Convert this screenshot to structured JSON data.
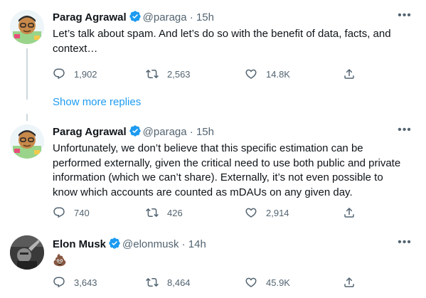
{
  "tweets": [
    {
      "name": "Parag Agrawal",
      "handle": "@paraga",
      "separator": "·",
      "time": "15h",
      "text": "Let’s talk about spam. And let’s do so with the benefit of data, facts, and\ncontext…",
      "replies": "1,902",
      "retweets": "2,563",
      "likes": "14.8K"
    },
    {
      "name": "Parag Agrawal",
      "handle": "@paraga",
      "separator": "·",
      "time": "15h",
      "text": "Unfortunately, we don’t believe that this specific estimation can be\nperformed externally, given the critical need to use both public and private\ninformation (which we can’t share). Externally, it’s not even possible to\nknow which accounts are counted as mDAUs on any given day.",
      "replies": "740",
      "retweets": "426",
      "likes": "2,914"
    },
    {
      "name": "Elon Musk",
      "handle": "@elonmusk",
      "separator": "·",
      "time": "14h",
      "text": "💩",
      "replies": "3,643",
      "retweets": "8,464",
      "likes": "45.9K"
    }
  ],
  "show_more_replies": "Show more replies",
  "more_icon": "•••",
  "colors": {
    "accent": "#1d9bf0",
    "secondary_text": "#536471",
    "thread_line": "#cfd9de"
  },
  "icons": [
    "reply-icon",
    "retweet-icon",
    "like-icon",
    "share-icon",
    "verified-badge-icon",
    "more-icon"
  ]
}
